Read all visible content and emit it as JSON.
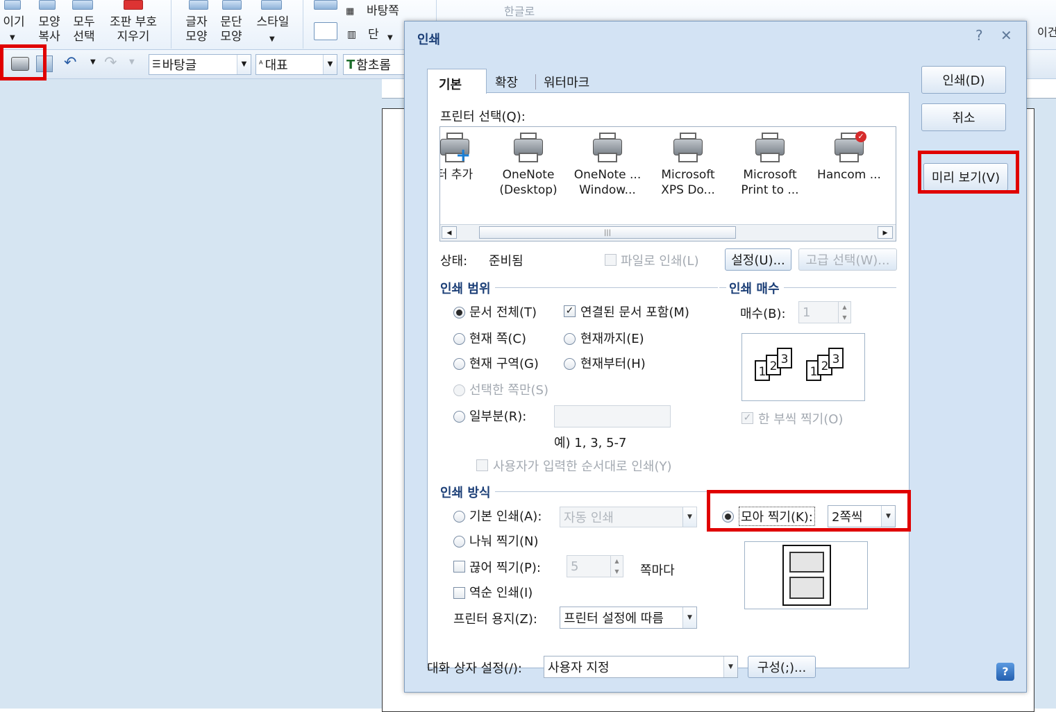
{
  "ribbon": {
    "items": [
      {
        "label": "이기"
      },
      {
        "label": "모양\n복사"
      },
      {
        "label": "모두\n선택"
      },
      {
        "label": "조판 부호\n지우기"
      },
      {
        "label": "글자\n모양"
      },
      {
        "label": "문단\n모양"
      },
      {
        "label": "스타일"
      },
      {
        "label": "바탕쪽"
      },
      {
        "label": "단"
      },
      {
        "label": "한글로"
      },
      {
        "label": "이건"
      }
    ]
  },
  "toolbar": {
    "style_combo": "바탕글",
    "rep_combo": "대표",
    "font_combo": "함초롬"
  },
  "dialog": {
    "title": "인쇄",
    "help": "?",
    "close": "✕",
    "tabs": [
      "기본",
      "확장",
      "워터마크"
    ],
    "buttons": {
      "print": "인쇄(D)",
      "cancel": "취소",
      "preview": "미리 보기(V)"
    },
    "printer_select_label": "프린터 선택(Q):",
    "printers": [
      {
        "name": "터 추가"
      },
      {
        "name": "OneNote\n(Desktop)"
      },
      {
        "name": "OneNote ...\nWindow..."
      },
      {
        "name": "Microsoft\nXPS Do..."
      },
      {
        "name": "Microsoft\nPrint to ..."
      },
      {
        "name": "Hancom ..."
      }
    ],
    "status_label": "상태:",
    "status_value": "준비됨",
    "print_to_file": "파일로 인쇄(L)",
    "settings_btn": "설정(U)...",
    "advanced_btn": "고급 선택(W)...",
    "range": {
      "title": "인쇄 범위",
      "all_doc": "문서 전체(T)",
      "include_linked": "연결된 문서 포함(M)",
      "current_page": "현재 쪽(C)",
      "until_current": "현재까지(E)",
      "current_section": "현재 구역(G)",
      "from_current": "현재부터(H)",
      "selected_pages": "선택한 쪽만(S)",
      "partial": "일부분(R):",
      "example": "예) 1, 3, 5-7",
      "user_order": "사용자가 입력한 순서대로 인쇄(Y)"
    },
    "copies": {
      "title": "인쇄 매수",
      "label": "매수(B):",
      "value": "1",
      "collate": "한 부씩 찍기(O)"
    },
    "method": {
      "title": "인쇄 방식",
      "basic": "기본 인쇄(A):",
      "basic_value": "자동 인쇄",
      "split": "나눠 찍기(N)",
      "cut": "끊어 찍기(P):",
      "cut_value": "5",
      "per_page": "쪽마다",
      "reverse": "역순 인쇄(I)",
      "paper_label": "프린터 용지(Z):",
      "paper_value": "프린터 설정에 따름",
      "nup_label": "모아 찍기(K):",
      "nup_value": "2쪽씩"
    },
    "dialog_setting_label": "대화 상자 설정(/):",
    "dialog_setting_value": "사용자 지정",
    "compose_btn": "구성(;)..."
  },
  "colors": {
    "highlight": "#e00000",
    "accent": "#1c3f77"
  }
}
